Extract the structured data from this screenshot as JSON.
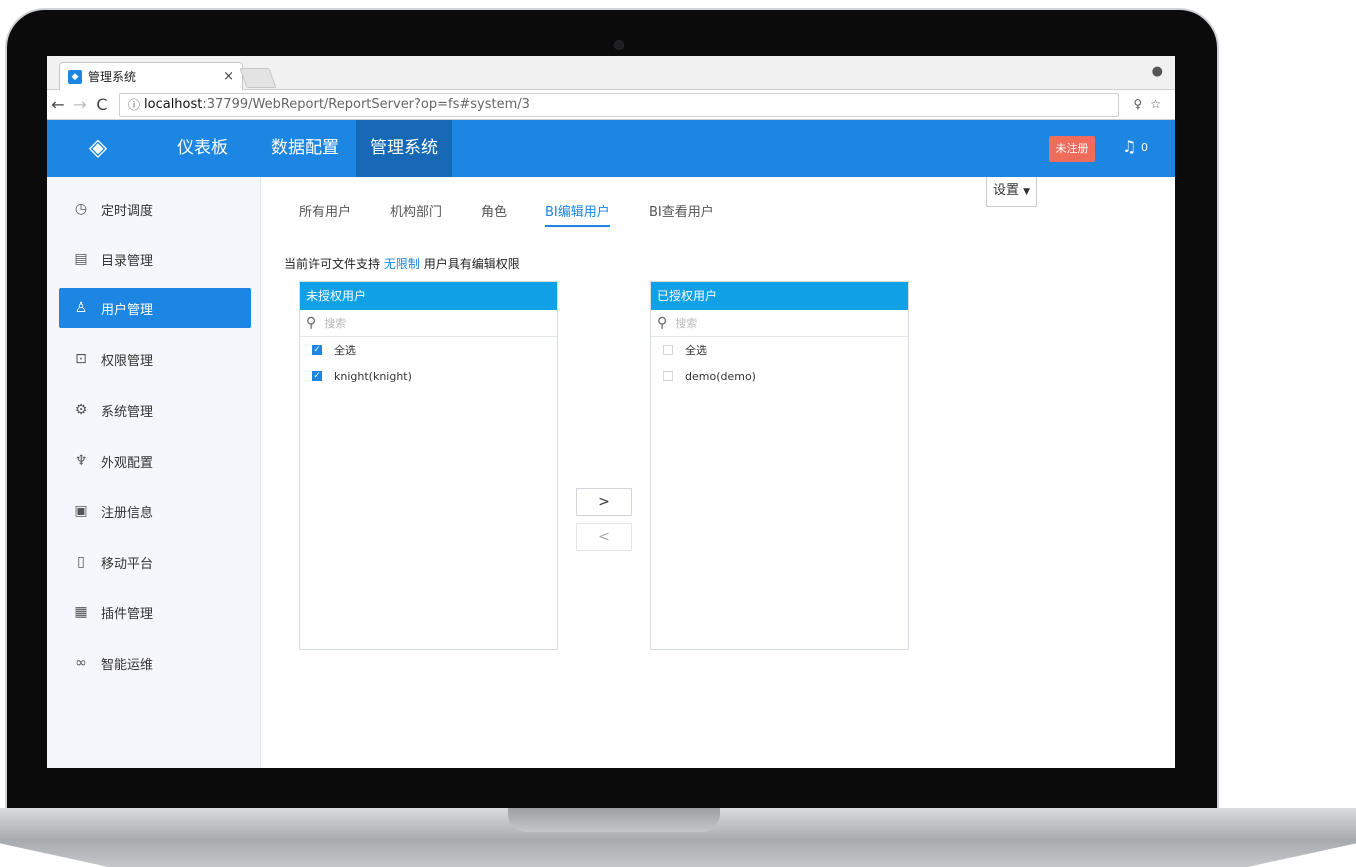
{
  "browser": {
    "tab_title": "管理系统",
    "tab_close": "×",
    "url_info_icon": "ⓘ",
    "url_host": "localhost",
    "url_rest": ":37799/WebReport/ReportServer?op=fs#system/3"
  },
  "header": {
    "logo_icon": "logo-icon",
    "nav": [
      "仪表板",
      "数据配置",
      "管理系统"
    ],
    "unregistered_label": "未注册",
    "notification_count": "0"
  },
  "sidebar": {
    "items": [
      {
        "label": "定时调度",
        "icon": "clock-icon"
      },
      {
        "label": "目录管理",
        "icon": "directory-icon"
      },
      {
        "label": "用户管理",
        "icon": "user-icon"
      },
      {
        "label": "权限管理",
        "icon": "lock-icon"
      },
      {
        "label": "系统管理",
        "icon": "gear-icon"
      },
      {
        "label": "外观配置",
        "icon": "brush-icon"
      },
      {
        "label": "注册信息",
        "icon": "register-icon"
      },
      {
        "label": "移动平台",
        "icon": "mobile-icon"
      },
      {
        "label": "插件管理",
        "icon": "plugin-icon"
      },
      {
        "label": "智能运维",
        "icon": "binoculars-icon"
      }
    ],
    "active_index": 2
  },
  "content": {
    "tabs": [
      "所有用户",
      "机构部门",
      "角色",
      "BI编辑用户",
      "BI查看用户"
    ],
    "active_tab": 3,
    "settings_label": "设置",
    "notice_prefix": "当前许可文件支持",
    "notice_highlight": "无限制",
    "notice_suffix": "用户具有编辑权限",
    "left_panel": {
      "title": "未授权用户",
      "search_placeholder": "搜索",
      "select_all": "全选",
      "users": [
        "knight(knight)"
      ]
    },
    "right_panel": {
      "title": "已授权用户",
      "search_placeholder": "搜索",
      "select_all": "全选",
      "users": [
        "demo(demo)"
      ]
    },
    "move_right_label": ">",
    "move_left_label": "<"
  }
}
